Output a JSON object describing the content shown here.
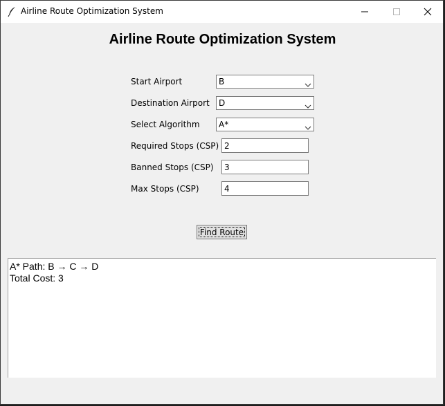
{
  "window": {
    "title": "Airline Route Optimization System",
    "controls": {
      "minimize": "minimize-icon",
      "maximize": "maximize-icon",
      "close": "close-icon"
    }
  },
  "heading": "Airline Route Optimization System",
  "form": {
    "start_airport": {
      "label": "Start Airport",
      "value": "B"
    },
    "destination_airport": {
      "label": "Destination Airport",
      "value": "D"
    },
    "algorithm": {
      "label": "Select Algorithm",
      "value": "A*"
    },
    "required_stops": {
      "label": "Required Stops (CSP)",
      "value": "2"
    },
    "banned_stops": {
      "label": "Banned Stops (CSP)",
      "value": "3"
    },
    "max_stops": {
      "label": "Max Stops (CSP)",
      "value": "4"
    }
  },
  "find_button_label": "Find Route",
  "output": {
    "lines": [
      "A* Path: B → C → D",
      "Total Cost: 3"
    ]
  },
  "colors": {
    "window_bg": "#f0f0f0",
    "titlebar_bg": "#ffffff",
    "field_border": "#7a7a7a",
    "button_bg": "#e1e1e1"
  }
}
